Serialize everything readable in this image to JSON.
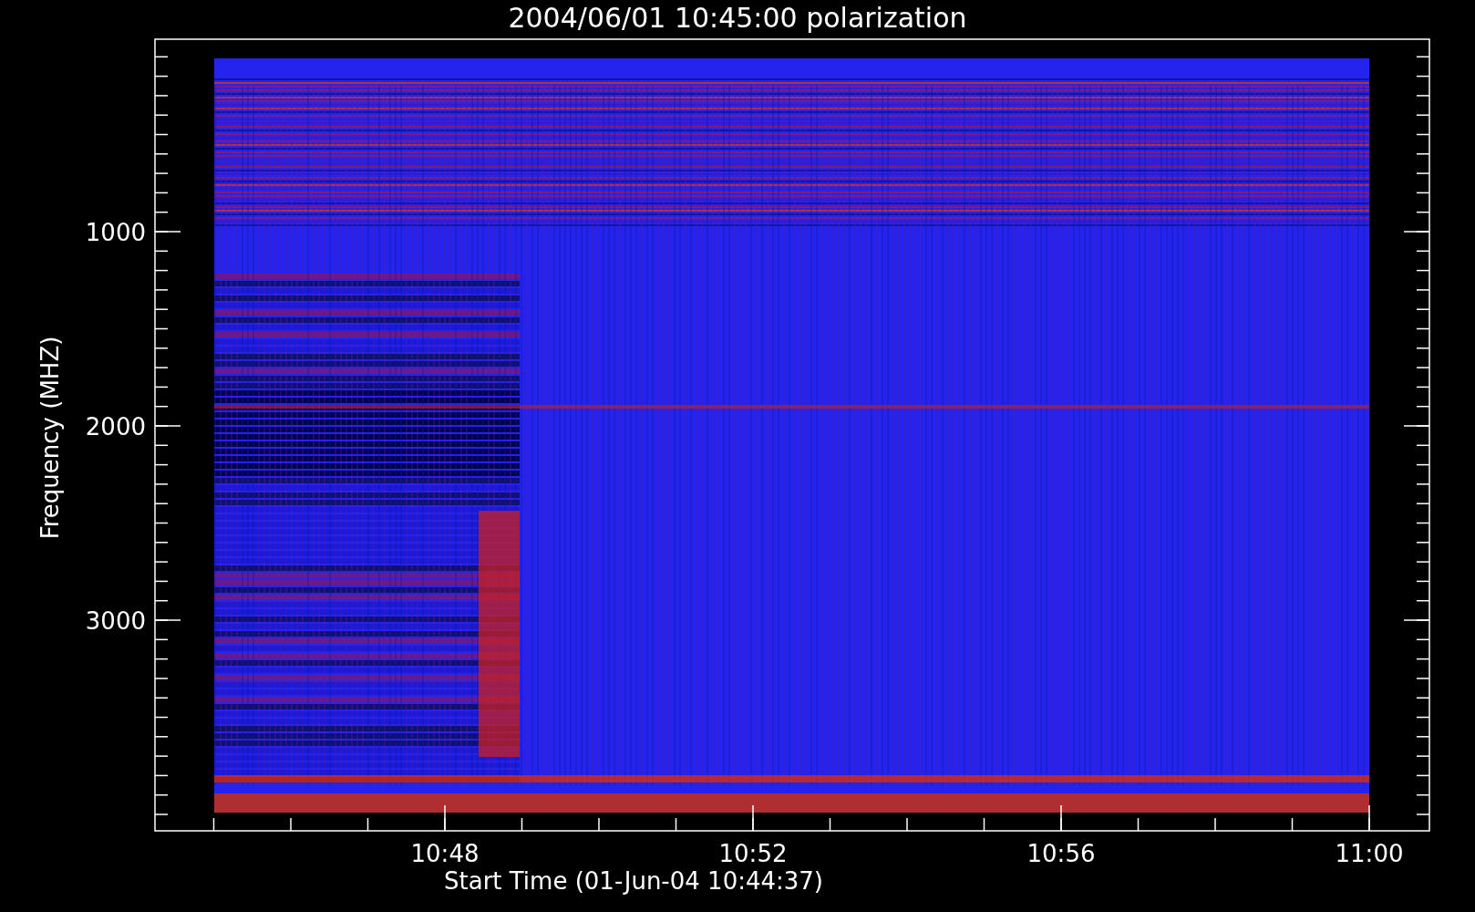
{
  "title": "2004/06/01 10:45:00 polarization",
  "y_axis": {
    "label": "Frequency (MHZ)",
    "ticks": [
      "1000",
      "2000",
      "3000"
    ]
  },
  "x_axis": {
    "label": "Start Time (01-Jun-04 10:44:37)",
    "ticks": [
      "10:48",
      "10:52",
      "10:56",
      "11:00"
    ]
  }
}
